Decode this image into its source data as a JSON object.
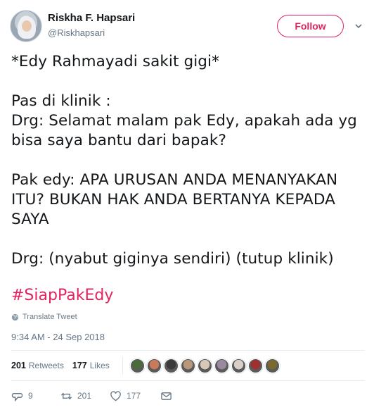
{
  "user": {
    "name": "Riskha F. Hapsari",
    "handle": "@Riskhapsari"
  },
  "follow_label": "Follow",
  "tweet": {
    "lines": [
      "*Edy Rahmayadi sakit gigi*",
      "Pas di klinik :",
      "Drg:  Selamat malam pak Edy,  apakah ada yg",
      "bisa saya bantu dari bapak?",
      "Pak edy: APA URUSAN ANDA MENANYAKAN",
      "ITU? BUKAN HAK ANDA BERTANYA KEPADA",
      "SAYA",
      "Drg: (nyabut giginya sendiri) (tutup klinik)"
    ],
    "hashtag": "#SiapPakEdy"
  },
  "translate_label": "Translate Tweet",
  "timestamp": "9:34 AM - 24 Sep 2018",
  "stats": {
    "retweets_count": "201",
    "retweets_label": "Retweets",
    "likes_count": "177",
    "likes_label": "Likes"
  },
  "liker_avatar_colors": [
    "#4a6b3a",
    "#c87a5a",
    "#3b3b3b",
    "#b89878",
    "#d8c8b8",
    "#9a8aa0",
    "#d8d0c8",
    "#a03030",
    "#7a6a30"
  ],
  "actions": {
    "reply_count": "9",
    "retweet_count": "201",
    "like_count": "177"
  },
  "colors": {
    "accent": "#e0245e",
    "secondary_text": "#657786",
    "primary_text": "#14171a"
  }
}
